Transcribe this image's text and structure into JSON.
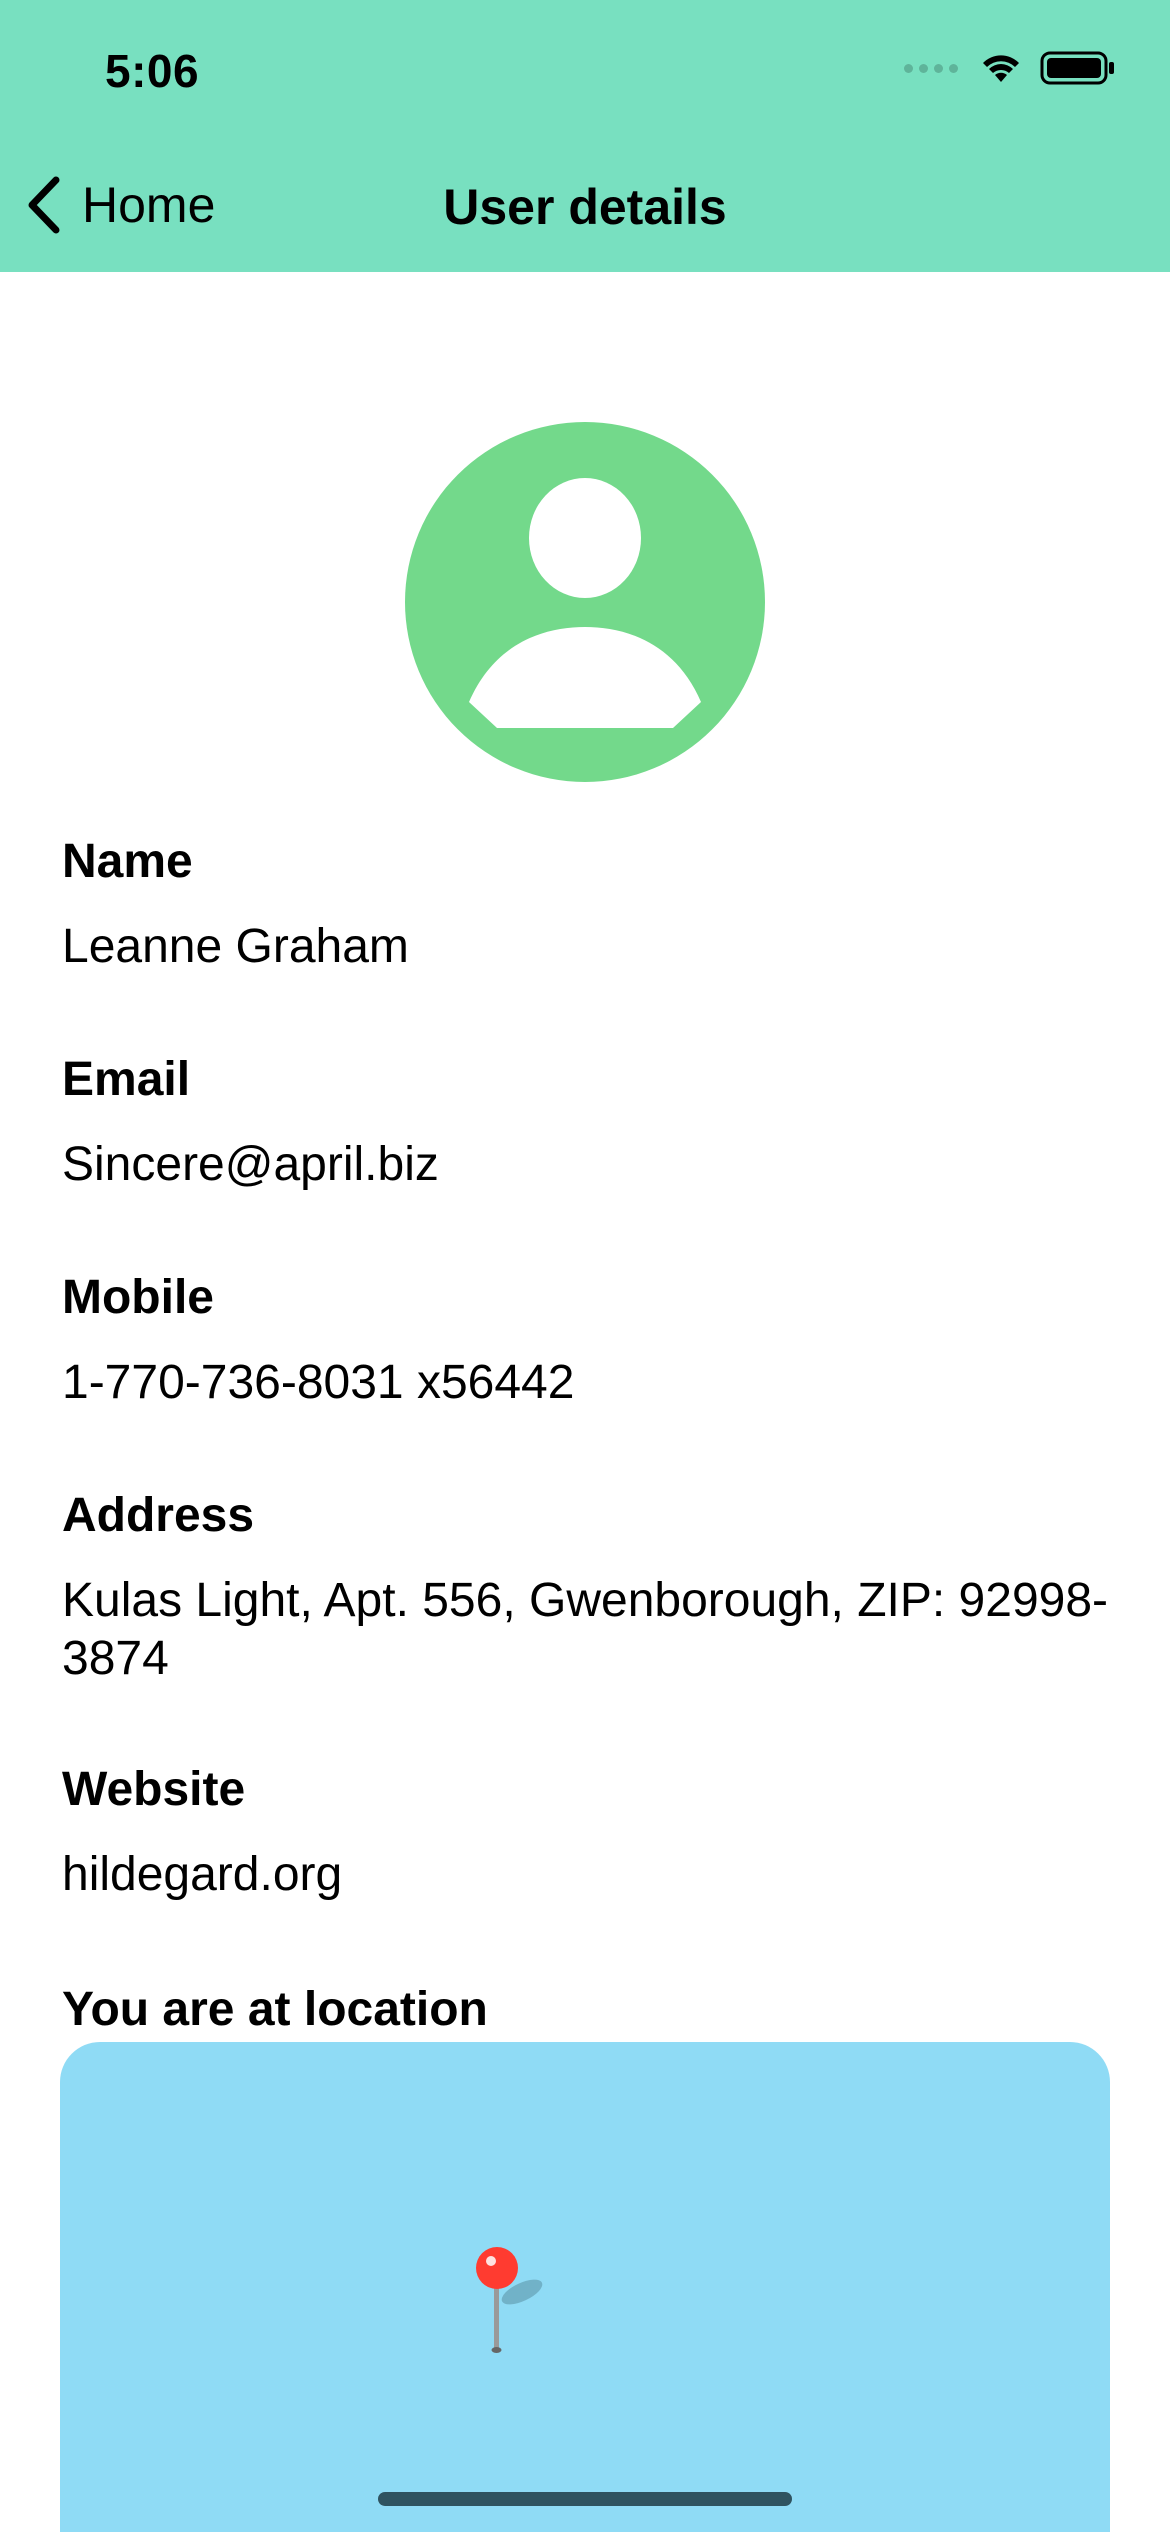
{
  "status_bar": {
    "time": "5:06"
  },
  "nav": {
    "back_label": "Home",
    "title": "User details"
  },
  "colors": {
    "header_bg": "#78e0c0",
    "avatar": "#73d98b",
    "map_bg": "#8fdbf5",
    "pin": "#ff3b30"
  },
  "fields": {
    "name": {
      "label": "Name",
      "value": "Leanne Graham"
    },
    "email": {
      "label": "Email",
      "value": "Sincere@april.biz"
    },
    "mobile": {
      "label": "Mobile",
      "value": "1-770-736-8031 x56442"
    },
    "address": {
      "label": "Address",
      "value": "Kulas Light, Apt. 556, Gwenborough, ZIP: 92998-3874"
    },
    "website": {
      "label": "Website",
      "value": "hildegard.org"
    }
  },
  "location": {
    "label": "You are at location"
  },
  "icons": {
    "back": "chevron-left-icon",
    "avatar": "person-circle-icon",
    "pin": "map-pin-icon",
    "wifi": "wifi-icon",
    "battery": "battery-icon",
    "cellular": "cellular-signal-icon"
  }
}
